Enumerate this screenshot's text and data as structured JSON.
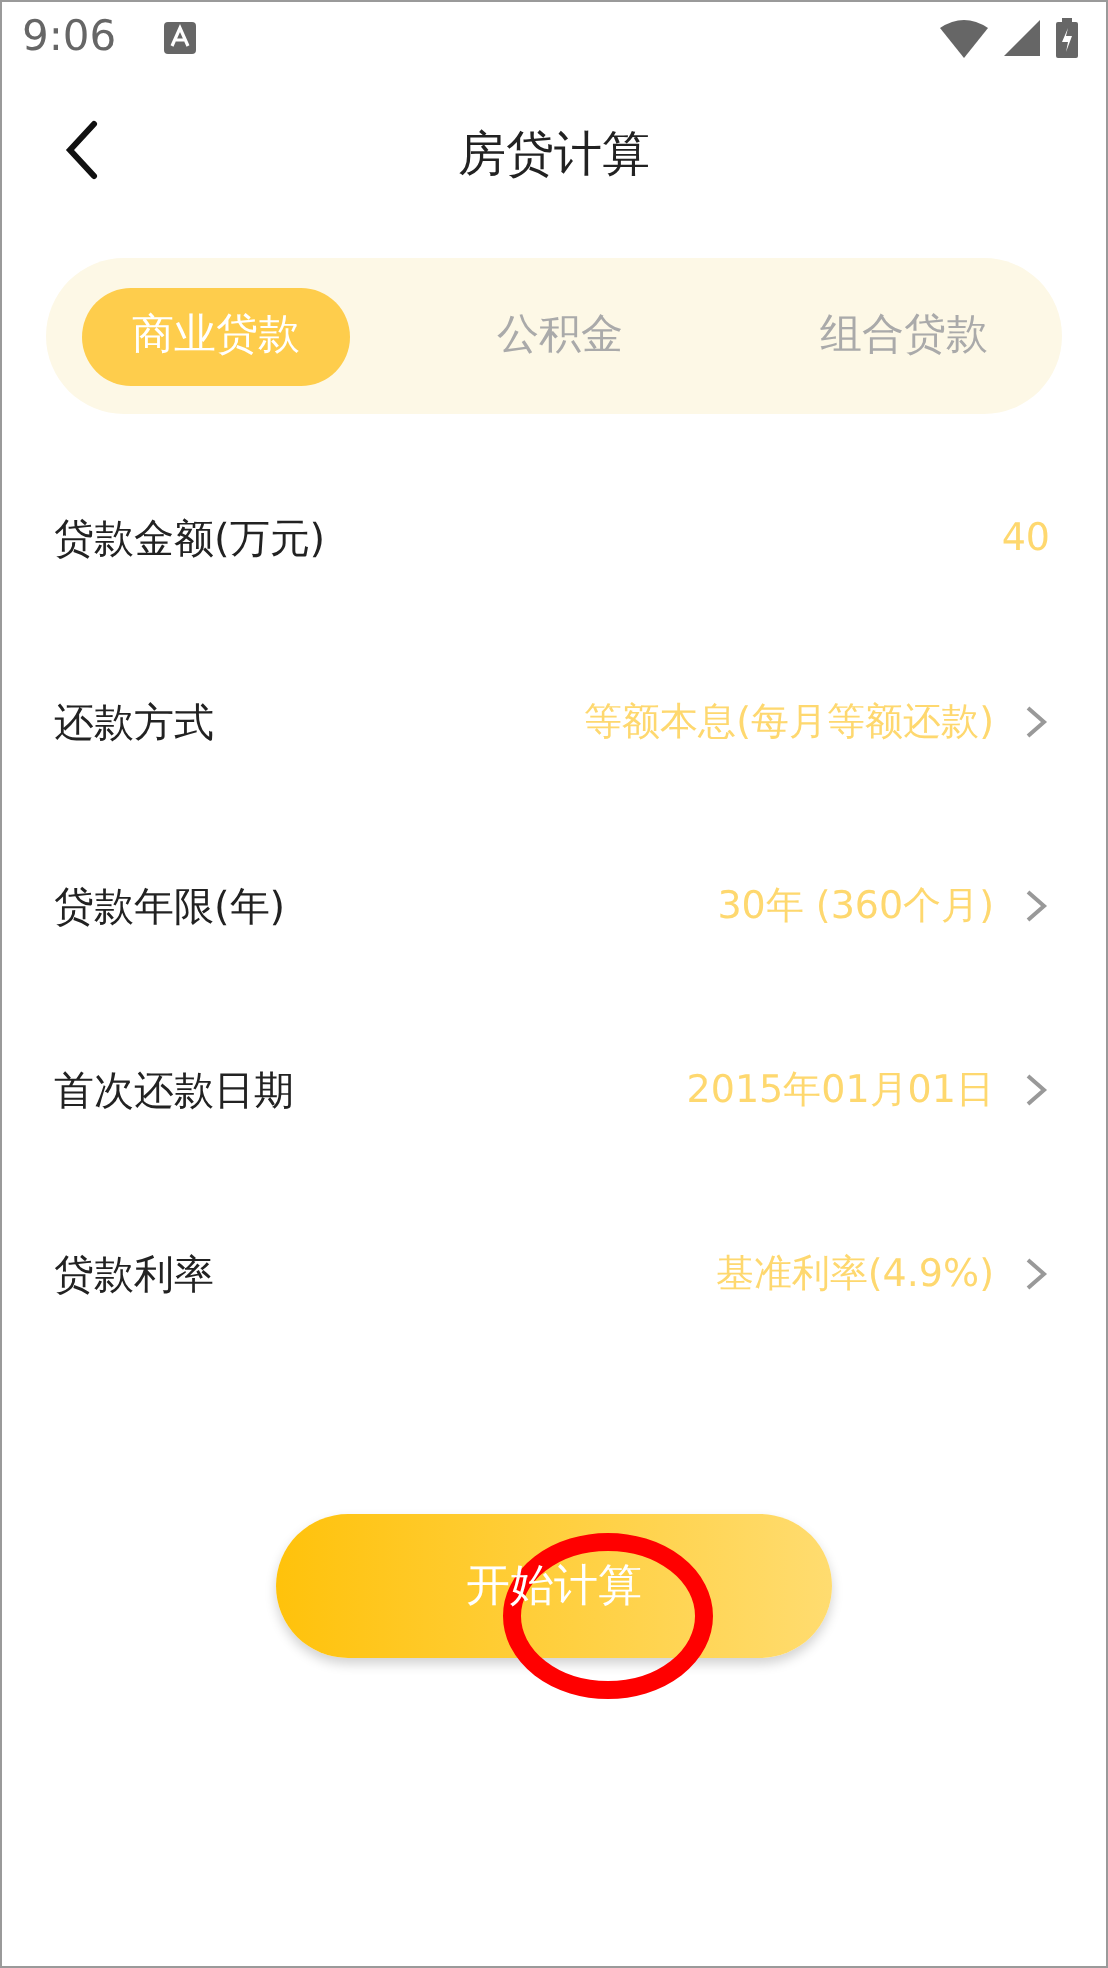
{
  "status_bar": {
    "time": "9:06"
  },
  "header": {
    "title": "房贷计算"
  },
  "tabs": [
    {
      "label": "商业贷款",
      "selected": true
    },
    {
      "label": "公积金",
      "selected": false
    },
    {
      "label": "组合贷款",
      "selected": false
    }
  ],
  "fields": [
    {
      "kind": "input",
      "label": "贷款金额(万元)",
      "value": "40"
    },
    {
      "kind": "select",
      "label": "还款方式",
      "value": "等额本息(每月等额还款)"
    },
    {
      "kind": "select",
      "label": "贷款年限(年)",
      "value": "30年 (360个月)"
    },
    {
      "kind": "select",
      "label": "首次还款日期",
      "value": "2015年01月01日"
    },
    {
      "kind": "select",
      "label": "贷款利率",
      "value": "基准利率(4.9%)"
    }
  ],
  "submit_button": {
    "label": "开始计算"
  },
  "annotation": {
    "kind": "ellipse"
  }
}
